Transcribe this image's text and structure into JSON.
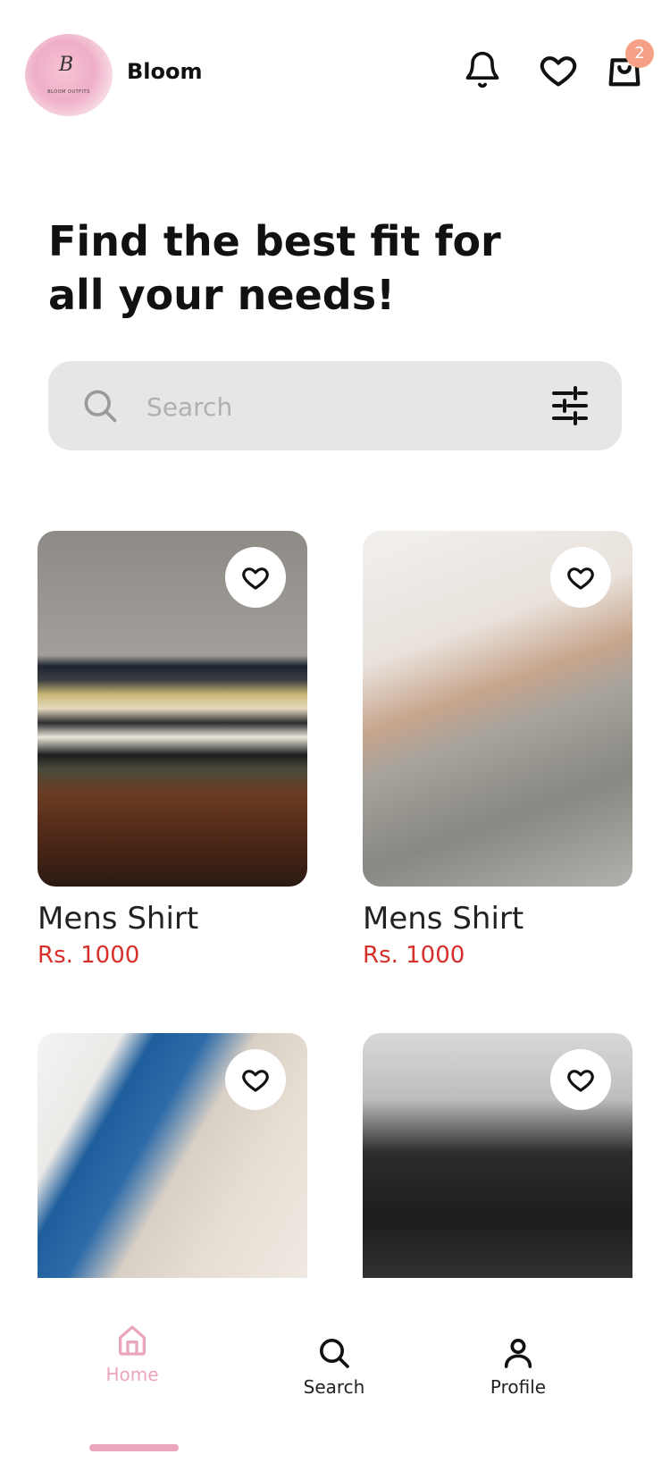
{
  "header": {
    "brand": "Bloom",
    "logo_monogram": "B",
    "logo_tagline": "BLOOM OUTFITS",
    "cart_count": "2",
    "icons": [
      "bell-icon",
      "heart-icon",
      "shopping-bag-icon"
    ]
  },
  "hero": {
    "line1": "Find the best fit for",
    "line2": "all your needs!"
  },
  "search": {
    "placeholder": "Search",
    "value": ""
  },
  "products": [
    {
      "name": "Mens Shirt",
      "price": "Rs. 1000"
    },
    {
      "name": "Mens Shirt",
      "price": "Rs. 1000"
    },
    {
      "name": "",
      "price": ""
    },
    {
      "name": "",
      "price": ""
    }
  ],
  "nav": {
    "home": "Home",
    "search": "Search",
    "profile": "Profile",
    "active": "home"
  },
  "colors": {
    "accent_pink": "#eaa6bc",
    "price_red": "#d7302a",
    "badge": "#f5a087",
    "search_bg": "#e6e6e6"
  }
}
